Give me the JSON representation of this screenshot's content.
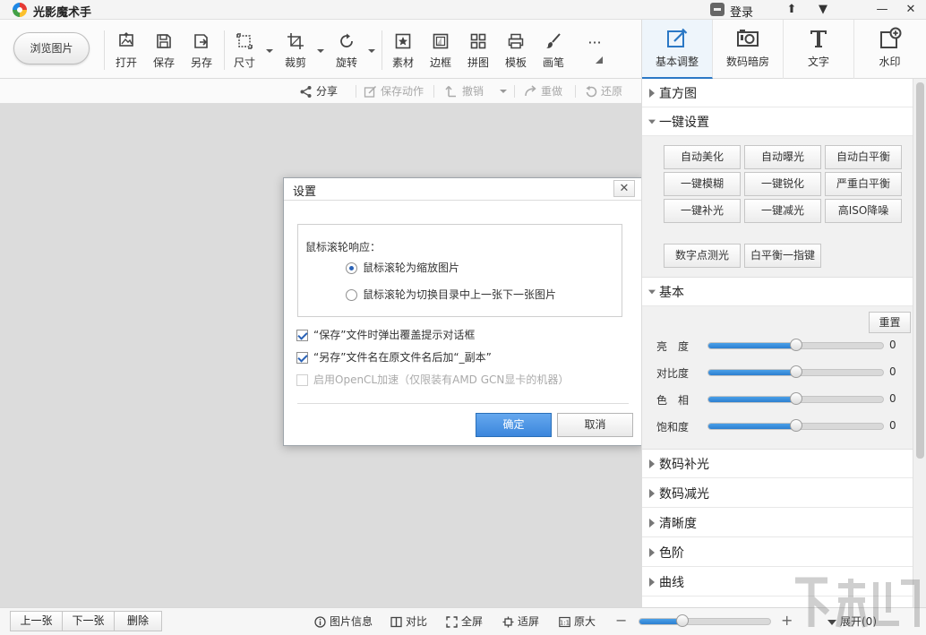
{
  "app": {
    "title": "光影魔术手",
    "login_label": "登录"
  },
  "window_controls": {
    "pin": "⬆",
    "menu": "▼",
    "minimize": "—",
    "maximize": "☐",
    "close": "✕"
  },
  "toolbar": {
    "browse_label": "浏览图片",
    "open_label": "打开",
    "save_label": "保存",
    "saveas_label": "另存",
    "size_label": "尺寸",
    "crop_label": "裁剪",
    "rotate_label": "旋转",
    "material_label": "素材",
    "border_label": "边框",
    "collage_label": "拼图",
    "template_label": "模板",
    "brush_label": "画笔",
    "more_label": "···"
  },
  "right_tabs": {
    "basic_label": "基本调整",
    "darkroom_label": "数码暗房",
    "text_label": "文字",
    "watermark_label": "水印"
  },
  "actionbar": {
    "share_label": "分享",
    "save_action_label": "保存动作",
    "undo_label": "撤销",
    "redo_label": "重做",
    "restore_label": "还原"
  },
  "dialog": {
    "title": "设置",
    "close_label": "✕",
    "group_label": "鼠标滚轮响应：",
    "radio_zoom": "鼠标滚轮为缩放图片",
    "radio_switch": "鼠标滚轮为切换目录中上一张下一张图片",
    "check_overwrite": "“保存”文件时弹出覆盖提示对话框",
    "check_copy_suffix": "“另存”文件名在原文件名后加“_副本”",
    "check_opencl": "启用OpenCL加速（仅限装有AMD GCN显卡的机器）",
    "ok_label": "确定",
    "cancel_label": "取消"
  },
  "panel": {
    "histogram": "直方图",
    "one_key": "一键设置",
    "one_key_buttons": [
      "自动美化",
      "自动曝光",
      "自动白平衡",
      "一键模糊",
      "一键锐化",
      "严重白平衡",
      "一键补光",
      "一键减光",
      "高ISO降噪"
    ],
    "spot_meter": "数字点测光",
    "wb_finger": "白平衡一指键",
    "basic": "基本",
    "reset_label": "重置",
    "sliders": [
      {
        "label": "亮　度",
        "value": "0",
        "level": 0.5
      },
      {
        "label": "对比度",
        "value": "0",
        "level": 0.5
      },
      {
        "label": "色　相",
        "value": "0",
        "level": 0.5
      },
      {
        "label": "饱和度",
        "value": "0",
        "level": 0.5
      }
    ],
    "fill_light": "数码补光",
    "reduce_light": "数码减光",
    "sharpness": "清晰度",
    "levels": "色阶",
    "curves": "曲线"
  },
  "bottombar": {
    "prev_label": "上一张",
    "next_label": "下一张",
    "delete_label": "删除",
    "info_label": "图片信息",
    "compare_label": "对比",
    "fullscreen_label": "全屏",
    "fit_label": "适屏",
    "original_label": "原大",
    "zoom_minus": "−",
    "zoom_plus": "+",
    "zoom_level": 0.33,
    "expand_label": "展开(0)"
  },
  "colors": {
    "accent": "#2b78c5",
    "ok_button": "#3b86dc",
    "slider": "#2d7fd0"
  }
}
